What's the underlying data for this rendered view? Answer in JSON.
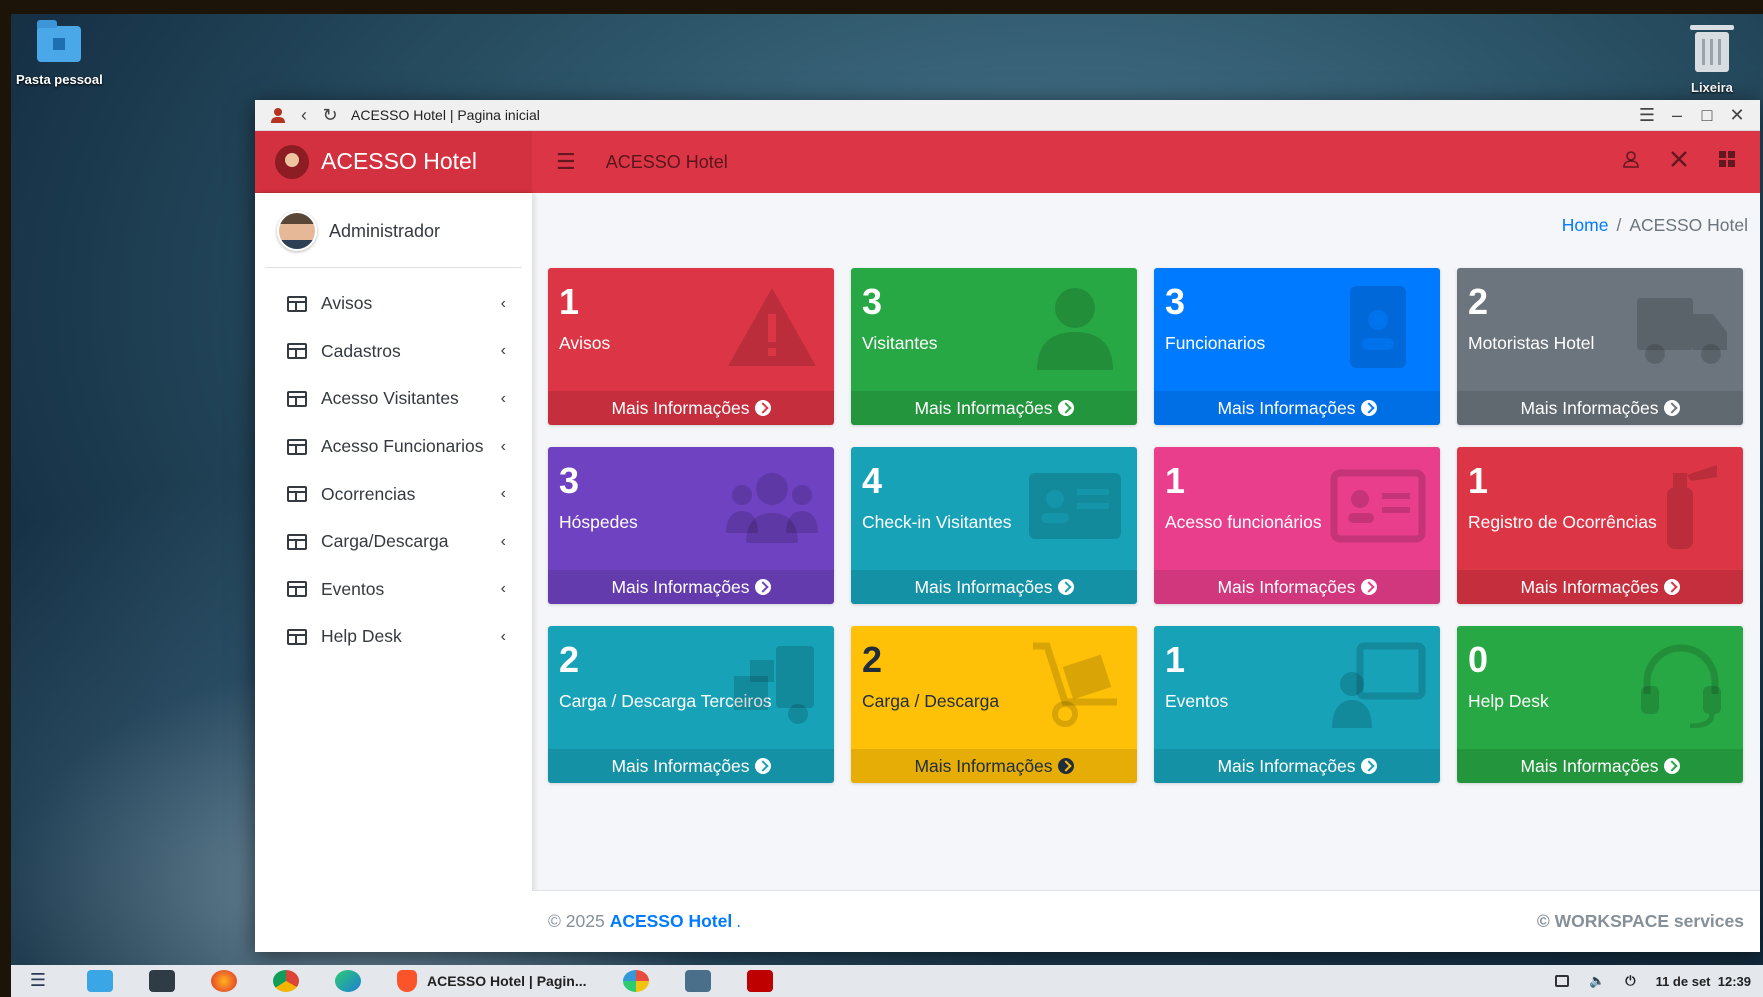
{
  "desktop": {
    "folder_label": "Pasta pessoal",
    "trash_label": "Lixeira"
  },
  "window": {
    "title": "ACESSO Hotel | Pagina inicial"
  },
  "app": {
    "brand": "ACESSO Hotel",
    "header_title": "ACESSO Hotel",
    "user_name": "Administrador",
    "accent_color": "#dc3545"
  },
  "sidebar": {
    "items": [
      {
        "label": "Avisos"
      },
      {
        "label": "Cadastros"
      },
      {
        "label": "Acesso Visitantes"
      },
      {
        "label": "Acesso Funcionarios"
      },
      {
        "label": "Ocorrencias"
      },
      {
        "label": "Carga/Descarga"
      },
      {
        "label": "Eventos"
      },
      {
        "label": "Help Desk"
      }
    ]
  },
  "breadcrumb": {
    "home": "Home",
    "separator": "/",
    "current": "ACESSO Hotel"
  },
  "cards": [
    {
      "count": "1",
      "label": "Avisos",
      "more": "Mais Informações",
      "color": "#dc3545",
      "icon": "warning-icon",
      "dark": false
    },
    {
      "count": "3",
      "label": "Visitantes",
      "more": "Mais Informações",
      "color": "#28a745",
      "icon": "user-tie-icon",
      "dark": false
    },
    {
      "count": "3",
      "label": "Funcionarios",
      "more": "Mais Informações",
      "color": "#007bff",
      "icon": "id-badge-icon",
      "dark": false
    },
    {
      "count": "2",
      "label": "Motoristas Hotel",
      "more": "Mais Informações",
      "color": "#6c757d",
      "icon": "truck-icon",
      "dark": false
    },
    {
      "count": "3",
      "label": "Hóspedes",
      "more": "Mais Informações",
      "color": "#6f42c1",
      "icon": "users-icon",
      "dark": false
    },
    {
      "count": "4",
      "label": "Check-in Visitantes",
      "more": "Mais Informações",
      "color": "#17a2b8",
      "icon": "id-card-icon",
      "dark": false
    },
    {
      "count": "1",
      "label": "Acesso funcionários",
      "more": "Mais Informações",
      "color": "#e83e8c",
      "icon": "address-card-icon",
      "dark": false
    },
    {
      "count": "1",
      "label": "Registro de Ocorrências",
      "more": "Mais Informações",
      "color": "#dc3545",
      "icon": "fire-extinguisher-icon",
      "dark": false
    },
    {
      "count": "2",
      "label": "Carga / Descarga Terceiros",
      "more": "Mais Informações",
      "color": "#17a2b8",
      "icon": "dolly-icon",
      "dark": false
    },
    {
      "count": "2",
      "label": "Carga / Descarga",
      "more": "Mais Informações",
      "color": "#ffc107",
      "icon": "hand-truck-icon",
      "dark": true
    },
    {
      "count": "1",
      "label": "Eventos",
      "more": "Mais Informações",
      "color": "#17a2b8",
      "icon": "presentation-icon",
      "dark": false
    },
    {
      "count": "0",
      "label": "Help Desk",
      "more": "Mais Informações",
      "color": "#28a745",
      "icon": "headset-icon",
      "dark": false
    }
  ],
  "footer": {
    "copyright": "© 2025",
    "brand": "ACESSO Hotel",
    "dot": ".",
    "right": "© WORKSPACE services"
  },
  "taskbar": {
    "active_task": "ACESSO Hotel | Pagin...",
    "date": "11 de set",
    "time": "12:39"
  }
}
